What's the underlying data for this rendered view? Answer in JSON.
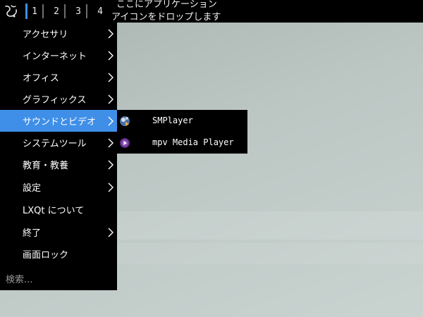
{
  "panel": {
    "desktops": [
      "1",
      "2",
      "3",
      "4"
    ],
    "active_desktop": "1",
    "quicklaunch_hint_line1": "ここにアプリケーション",
    "quicklaunch_hint_line2": "アイコンをドロップします"
  },
  "menu": {
    "items": [
      {
        "label": "アクセサリ",
        "has_submenu": true
      },
      {
        "label": "インターネット",
        "has_submenu": true
      },
      {
        "label": "オフィス",
        "has_submenu": true
      },
      {
        "label": "グラフィックス",
        "has_submenu": true
      },
      {
        "label": "サウンドとビデオ",
        "has_submenu": true,
        "highlighted": true
      },
      {
        "label": "システムツール",
        "has_submenu": true
      },
      {
        "label": "教育・教養",
        "has_submenu": true
      },
      {
        "label": "設定",
        "has_submenu": true
      },
      {
        "label": "LXQt について",
        "has_submenu": false
      },
      {
        "label": "終了",
        "has_submenu": true
      },
      {
        "label": "画面ロック",
        "has_submenu": false
      }
    ],
    "search_placeholder": "検索..."
  },
  "submenu": {
    "items": [
      {
        "label": "SMPlayer",
        "icon": "smplayer-icon"
      },
      {
        "label": "mpv Media Player",
        "icon": "mpv-icon"
      }
    ]
  },
  "colors": {
    "highlight": "#3f8fe8",
    "panel_bg": "#000000",
    "desktop_bg": "#bcc7c4"
  }
}
